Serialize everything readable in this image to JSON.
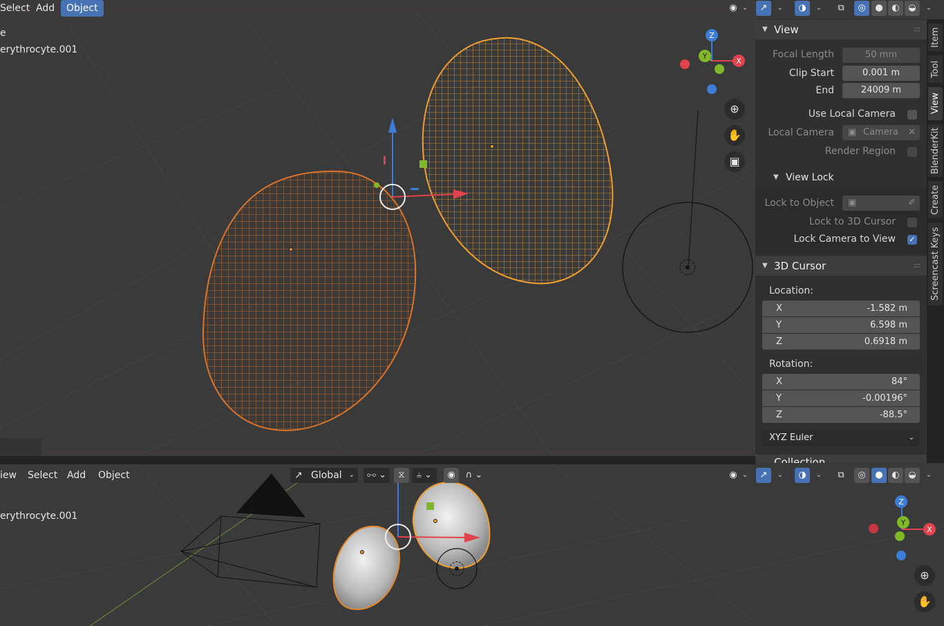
{
  "top_header": {
    "menu": [
      "Select",
      "Add",
      "Object"
    ],
    "active_menu": "Object"
  },
  "top_viewport": {
    "info_line1": "e",
    "info_line2": "erythrocyte.001"
  },
  "side_tabs": [
    "Item",
    "Tool",
    "View",
    "BlenderKit",
    "Create",
    "Screencast Keys"
  ],
  "active_tab": "View",
  "view_panel": {
    "title": "View",
    "focal_length_label": "Focal Length",
    "focal_length_value": "50 mm",
    "clip_start_label": "Clip Start",
    "clip_start_value": "0.001 m",
    "end_label": "End",
    "end_value": "24009 m",
    "use_local_camera_label": "Use Local Camera",
    "local_camera_label": "Local Camera",
    "local_camera_value": "Camera",
    "render_region_label": "Render Region",
    "view_lock": {
      "title": "View Lock",
      "lock_to_object_label": "Lock to Object",
      "lock_to_cursor_label": "Lock to 3D Cursor",
      "lock_camera_label": "Lock Camera to View",
      "lock_camera_checked": true
    }
  },
  "cursor_panel": {
    "title": "3D Cursor",
    "location_label": "Location:",
    "location": [
      {
        "axis": "X",
        "value": "-1.582 m"
      },
      {
        "axis": "Y",
        "value": "6.598 m"
      },
      {
        "axis": "Z",
        "value": "0.6918 m"
      }
    ],
    "rotation_label": "Rotation:",
    "rotation": [
      {
        "axis": "X",
        "value": "84°"
      },
      {
        "axis": "Y",
        "value": "-0.00196°"
      },
      {
        "axis": "Z",
        "value": "-88.5°"
      }
    ],
    "rotation_mode": "XYZ Euler",
    "next_section_partial": "Collection"
  },
  "bottom_header": {
    "menu": [
      "iew",
      "Select",
      "Add",
      "Object"
    ],
    "orientation": "Global"
  },
  "bottom_viewport": {
    "info_line": "erythrocyte.001"
  },
  "gizmo_labels": {
    "x": "X",
    "y": "Y",
    "z": "Z"
  },
  "colors": {
    "accent": "#4772b3",
    "selected_orange": "#e38a2e",
    "active_orange": "#f0a030",
    "axis_x": "#e0424e",
    "axis_y": "#80b82a",
    "axis_z": "#3b7dd8"
  }
}
